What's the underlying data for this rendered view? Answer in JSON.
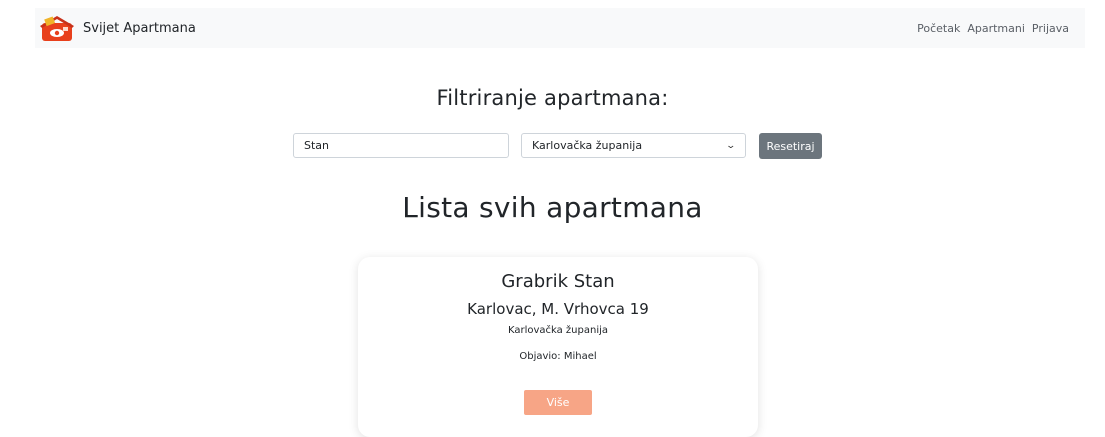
{
  "navbar": {
    "brand_name": "Svijet Apartmana",
    "links": [
      {
        "label": "Početak"
      },
      {
        "label": "Apartmani"
      },
      {
        "label": "Prijava"
      }
    ]
  },
  "filter": {
    "title": "Filtriranje apartmana:",
    "search_value": "Stan",
    "county_selected": "Karlovačka županija",
    "reset_label": "Resetiraj"
  },
  "list": {
    "title": "Lista svih apartmana",
    "cards": [
      {
        "name": "Grabrik Stan",
        "address": "Karlovac, M. Vrhovca 19",
        "county": "Karlovačka županija",
        "author_prefix": "Objavio:",
        "author": "Mihael",
        "more_label": "Više"
      }
    ]
  },
  "colors": {
    "navbar_bg": "#f8f9fa",
    "reset_button": "#6c757d",
    "more_button": "#f7a586",
    "logo_red": "#e8401c"
  },
  "icons": {
    "brand_logo": "house-logo-icon",
    "select_caret": "chevron-down-icon"
  }
}
